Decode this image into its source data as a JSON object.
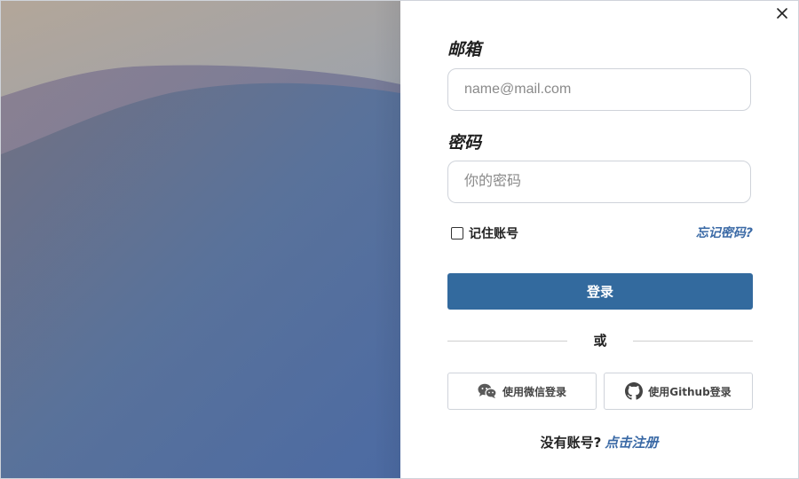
{
  "form": {
    "email_label": "邮箱",
    "email_placeholder": "name@mail.com",
    "password_label": "密码",
    "password_placeholder": "你的密码",
    "remember_label": "记住账号",
    "forgot_link": "忘记密码?",
    "login_button": "登录",
    "divider_text": "或",
    "wechat_login": "使用微信登录",
    "github_login": "使用Github登录",
    "signup_prompt": "没有账号?",
    "signup_link": "点击注册"
  },
  "icons": {
    "close": "close-icon",
    "wechat": "wechat-icon",
    "github": "github-icon"
  },
  "colors": {
    "accent": "#336a9e",
    "link": "#3b6aa6"
  }
}
